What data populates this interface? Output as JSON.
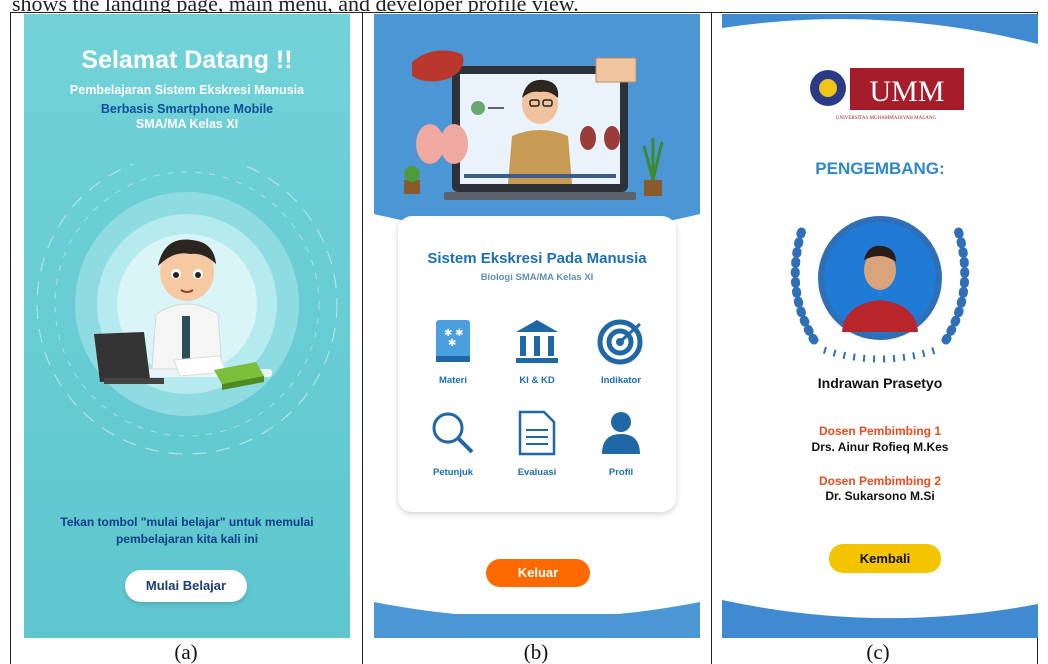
{
  "caption_top": "shows the landing page, main menu, and developer profile view.",
  "labels": [
    "(a)",
    "(b)",
    "(c)"
  ],
  "landing": {
    "title": "Selamat Datang !!",
    "subtitle_1": "Pembelajaran Sistem Ekskresi Manusia",
    "subtitle_2": "Berbasis  Smartphone Mobile",
    "subtitle_3": "SMA/MA Kelas XI",
    "instruction_line_1": "Tekan tombol \"mulai belajar\" untuk memulai",
    "instruction_line_2": "pembelajaran kita kali ini",
    "button_label": "Mulai Belajar"
  },
  "menu": {
    "title": "Sistem Ekskresi Pada Manusia",
    "subtitle": "Biologi SMA/MA Kelas XI",
    "items": [
      {
        "label": "Materi",
        "icon": "book-icon"
      },
      {
        "label": "KI & KD",
        "icon": "institution-icon"
      },
      {
        "label": "Indikator",
        "icon": "target-icon"
      },
      {
        "label": "Petunjuk",
        "icon": "magnifier-icon"
      },
      {
        "label": "Evaluasi",
        "icon": "document-icon"
      },
      {
        "label": "Profil",
        "icon": "user-icon"
      }
    ],
    "button_label": "Keluar"
  },
  "profile": {
    "logo_text": "UMM",
    "logo_subtext": "UNIVERSITAS MUHAMMADIYAH MALANG",
    "title": "PENGEMBANG:",
    "developer_name": "Indrawan Prasetyo",
    "role_1": "Dosen Pembimbing 1",
    "person_1": "Drs. Ainur Rofieq M.Kes",
    "role_2": "Dosen Pembimbing 2",
    "person_2": "Dr. Sukarsono M.Si",
    "button_label": "Kembali"
  },
  "colors": {
    "landing_bg": "#66cbd3",
    "menu_bg": "#4b97d6",
    "profile_bg": "#3f8ad1",
    "exit_button": "#ff6a00",
    "back_button": "#f5c400",
    "role_text": "#e74c1c"
  }
}
